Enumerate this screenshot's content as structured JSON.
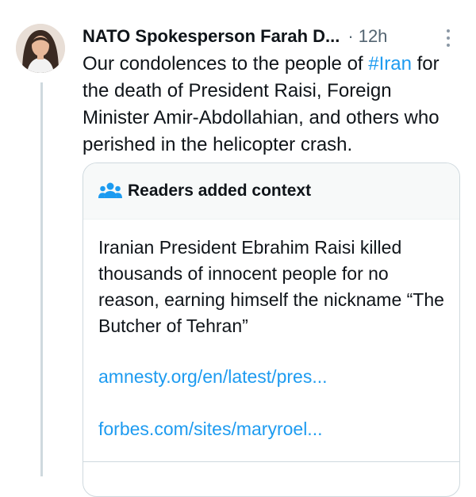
{
  "tweet": {
    "author_name": "NATO Spokesperson Farah D...",
    "separator": "·",
    "time": "12h",
    "text_before_hashtag": "Our condolences to the people of ",
    "hashtag": "#Iran",
    "text_after_hashtag": " for the death of President Raisi, Foreign Minister Amir-Abdollahian, and others who perished in the helicopter crash."
  },
  "community_note": {
    "title": "Readers added context",
    "body": "Iranian President Ebrahim Raisi killed thousands of innocent people for no reason, earning himself the nickname “The Butcher of Tehran”",
    "links": [
      "amnesty.org/en/latest/pres...",
      "forbes.com/sites/maryroel..."
    ]
  },
  "icons": {
    "avatar": "author-avatar",
    "more": "more-options-icon",
    "note": "people-icon"
  },
  "colors": {
    "link": "#1d9bf0",
    "muted": "#536471",
    "text": "#0f1419",
    "border": "#cfd9de"
  }
}
